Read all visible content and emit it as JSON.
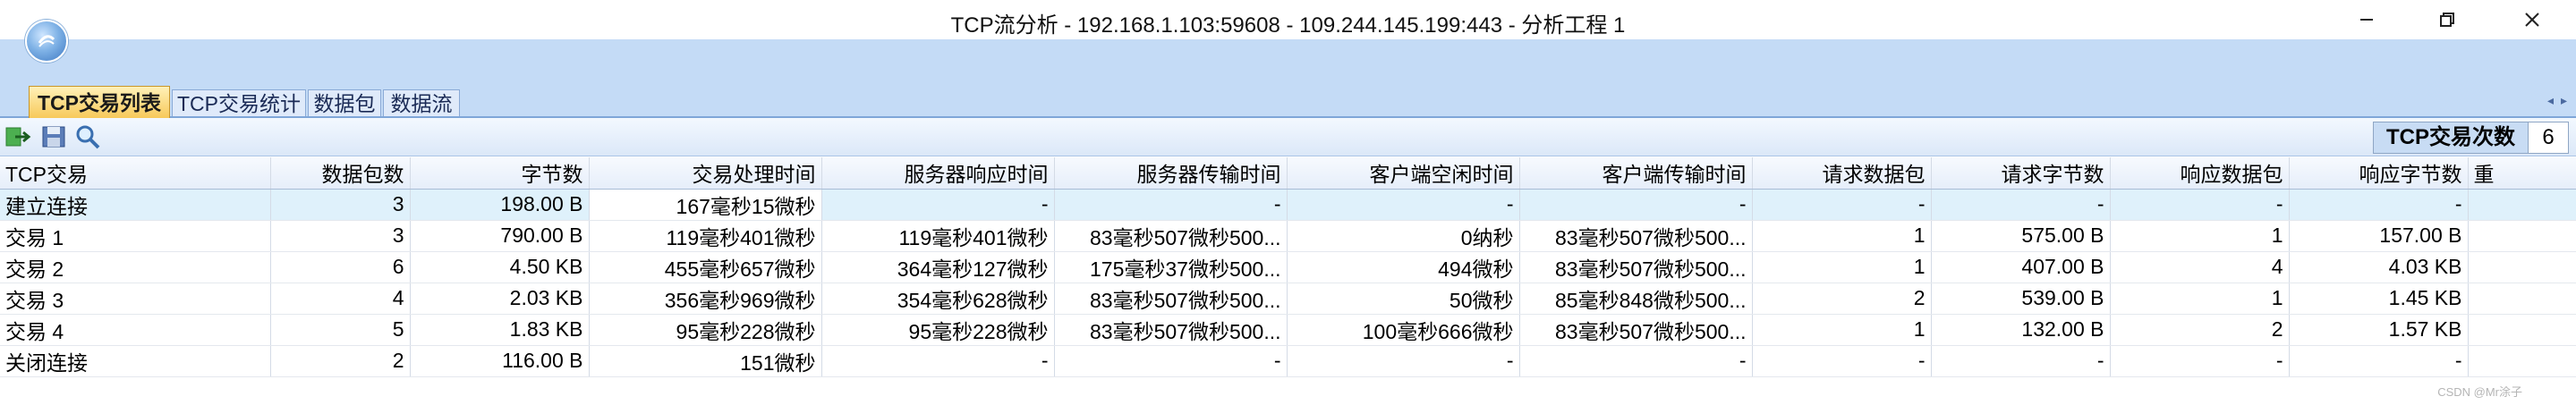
{
  "window": {
    "title": "TCP流分析 - 192.168.1.103:59608 - 109.244.145.199:443 - 分析工程 1"
  },
  "tabs": [
    {
      "label": "TCP交易列表",
      "active": true
    },
    {
      "label": "TCP交易统计",
      "active": false
    },
    {
      "label": "数据包",
      "active": false
    },
    {
      "label": "数据流",
      "active": false
    }
  ],
  "tab_scroll": "◂ ▸",
  "toolbar": {
    "icons": [
      "export-icon",
      "save-icon",
      "search-icon"
    ],
    "count_label": "TCP交易次数",
    "count_value": "6"
  },
  "table": {
    "columns": [
      "TCP交易",
      "数据包数",
      "字节数",
      "交易处理时间",
      "服务器响应时间",
      "服务器传输时间",
      "客户端空闲时间",
      "客户端传输时间",
      "请求数据包",
      "请求字节数",
      "响应数据包",
      "响应字节数",
      "重"
    ],
    "rows": [
      [
        "建立连接",
        "3",
        "198.00 B",
        "167毫秒15微秒",
        "-",
        "-",
        "-",
        "-",
        "-",
        "-",
        "-",
        "-",
        ""
      ],
      [
        "交易 1",
        "3",
        "790.00 B",
        "119毫秒401微秒",
        "119毫秒401微秒",
        "83毫秒507微秒500...",
        "0纳秒",
        "83毫秒507微秒500...",
        "1",
        "575.00 B",
        "1",
        "157.00 B",
        ""
      ],
      [
        "交易 2",
        "6",
        "4.50 KB",
        "455毫秒657微秒",
        "364毫秒127微秒",
        "175毫秒37微秒500...",
        "494微秒",
        "83毫秒507微秒500...",
        "1",
        "407.00 B",
        "4",
        "4.03 KB",
        ""
      ],
      [
        "交易 3",
        "4",
        "2.03 KB",
        "356毫秒969微秒",
        "354毫秒628微秒",
        "83毫秒507微秒500...",
        "50微秒",
        "85毫秒848微秒500...",
        "2",
        "539.00 B",
        "1",
        "1.45 KB",
        ""
      ],
      [
        "交易 4",
        "5",
        "1.83 KB",
        "95毫秒228微秒",
        "95毫秒228微秒",
        "83毫秒507微秒500...",
        "100毫秒666微秒",
        "83毫秒507微秒500...",
        "1",
        "132.00 B",
        "2",
        "1.57 KB",
        ""
      ],
      [
        "关闭连接",
        "2",
        "116.00 B",
        "151微秒",
        "-",
        "-",
        "-",
        "-",
        "-",
        "-",
        "-",
        "-",
        ""
      ]
    ]
  },
  "watermark": "CSDN @Mr涂子"
}
